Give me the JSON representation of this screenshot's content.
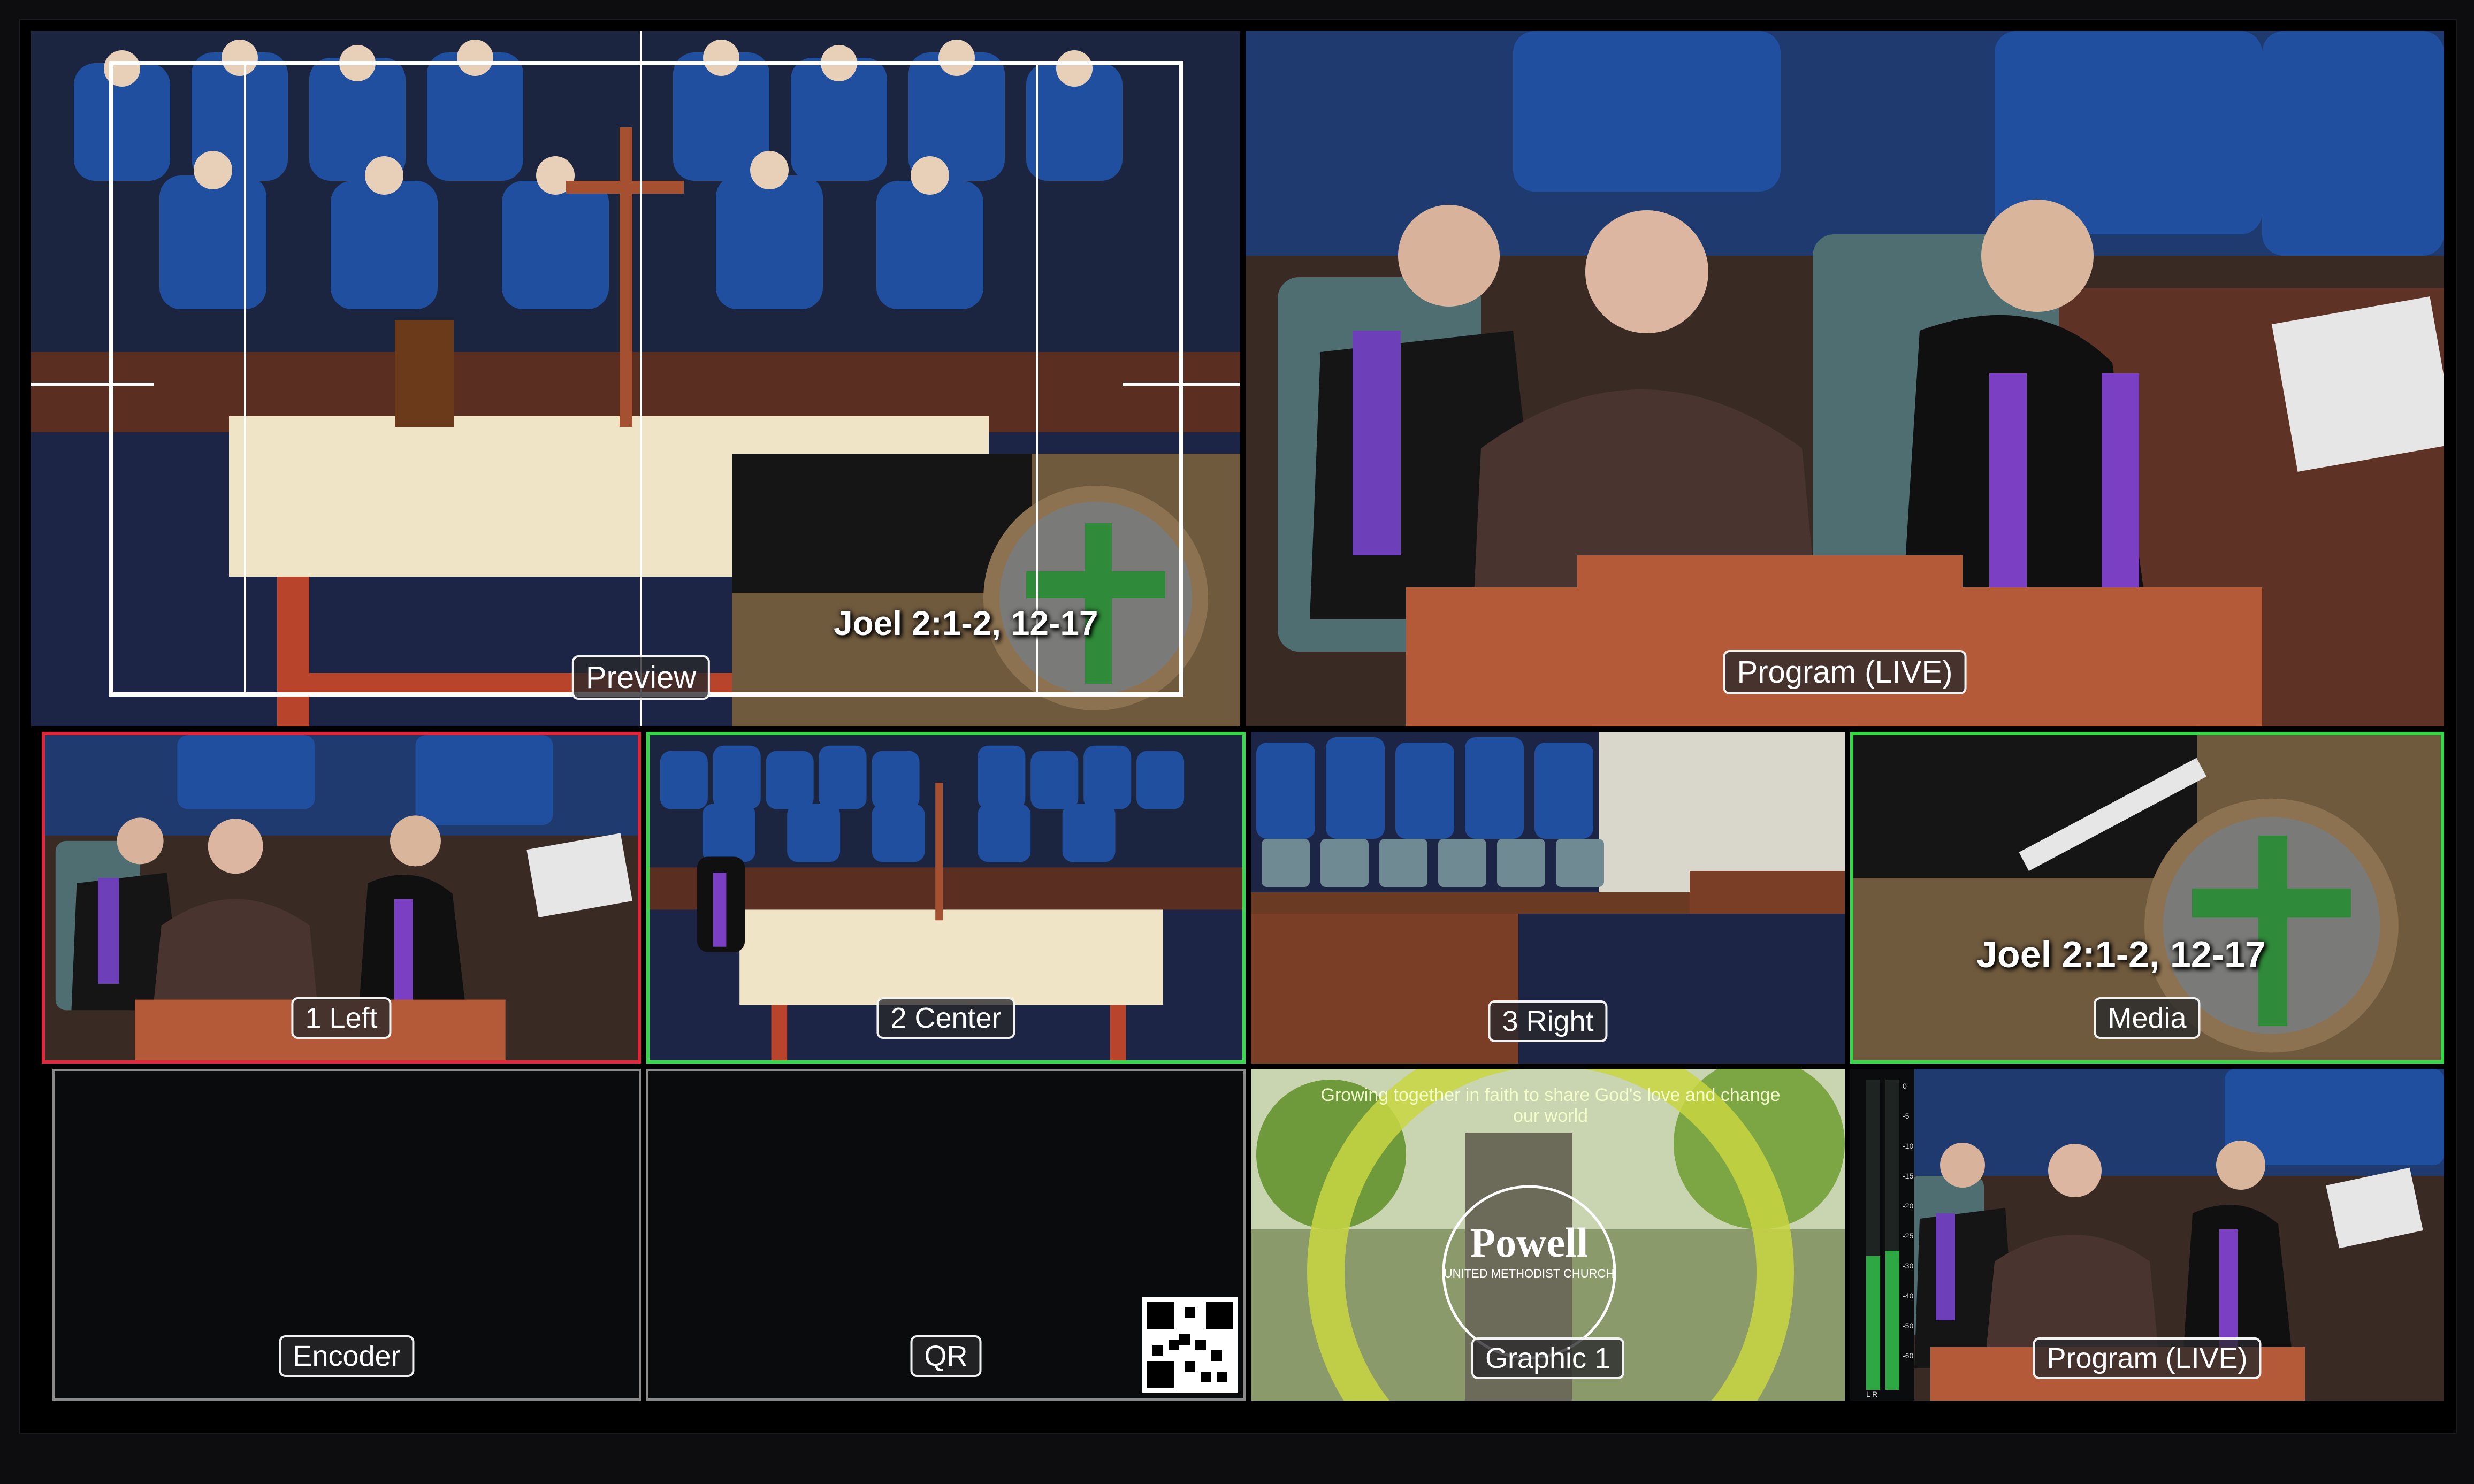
{
  "tiles": {
    "preview": {
      "label": "Preview",
      "overlay": "Joel 2:1-2, 12-17"
    },
    "program": {
      "label": "Program (LIVE)"
    },
    "left": {
      "label": "1 Left"
    },
    "center": {
      "label": "2 Center"
    },
    "right": {
      "label": "3 Right"
    },
    "media": {
      "label": "Media",
      "overlay": "Joel 2:1-2, 12-17"
    },
    "encoder": {
      "label": "Encoder"
    },
    "qr": {
      "label": "QR"
    },
    "graphic": {
      "label": "Graphic 1",
      "logo": "Powell",
      "logo_sub": "UNITED METHODIST CHURCH",
      "arc_text": "Growing together in faith to share God's love and change our world"
    },
    "program_small": {
      "label": "Program (LIVE)",
      "vu_ticks": [
        "0",
        "-5",
        "-10",
        "-15",
        "-20",
        "-25",
        "-30",
        "-40",
        "-50",
        "-60"
      ],
      "vu_channels": "L R"
    }
  },
  "colors": {
    "live_border": "#e0283c",
    "preview_border": "#38d64a",
    "robe": "#1f4f9e",
    "stole": "#7b3fc4"
  },
  "icons": [
    "qr-code-icon",
    "cross-icon",
    "microphone-icon"
  ]
}
